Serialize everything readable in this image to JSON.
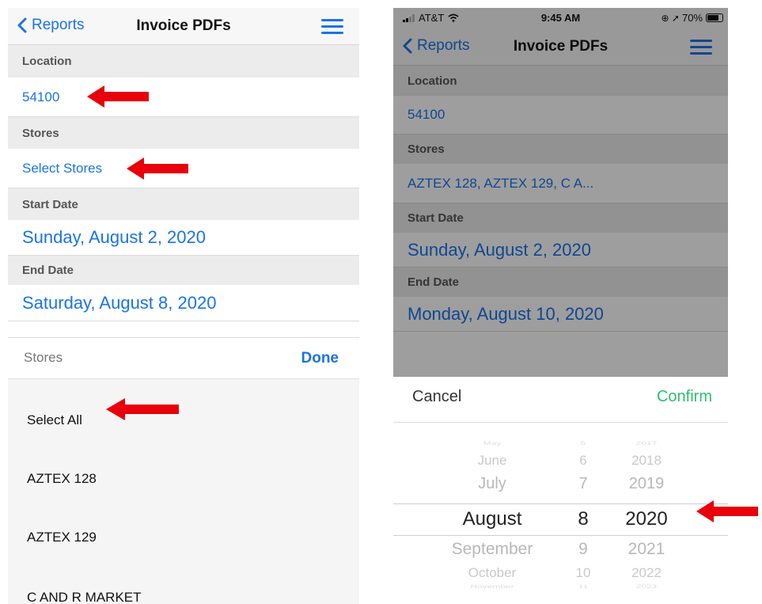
{
  "left": {
    "nav": {
      "back_label": "Reports",
      "title": "Invoice PDFs"
    },
    "location": {
      "header": "Location",
      "value": "54100"
    },
    "stores": {
      "header": "Stores",
      "value": "Select Stores"
    },
    "start_date": {
      "header": "Start Date",
      "value": "Sunday, August 2, 2020"
    },
    "end_date": {
      "header": "End Date",
      "value": "Saturday, August 8, 2020"
    },
    "sheet": {
      "label": "Stores",
      "done_label": "Done",
      "options": [
        "Select All",
        "AZTEX 128",
        "AZTEX 129",
        "C AND R MARKET"
      ]
    }
  },
  "right": {
    "status": {
      "carrier": "AT&T",
      "time": "9:45 AM",
      "battery": "70%"
    },
    "nav": {
      "back_label": "Reports",
      "title": "Invoice PDFs"
    },
    "location": {
      "header": "Location",
      "value": "54100"
    },
    "stores": {
      "header": "Stores",
      "value": "AZTEX 128, AZTEX 129, C A..."
    },
    "start_date": {
      "header": "Start Date",
      "value": "Sunday, August 2, 2020"
    },
    "end_date": {
      "header": "End Date",
      "value": "Monday, August 10, 2020"
    },
    "picker": {
      "cancel_label": "Cancel",
      "confirm_label": "Confirm",
      "months": [
        "May",
        "June",
        "July",
        "August",
        "September",
        "October",
        "November"
      ],
      "days": [
        "5",
        "6",
        "7",
        "8",
        "9",
        "10",
        "11"
      ],
      "years": [
        "2017",
        "2018",
        "2019",
        "2020",
        "2021",
        "2022",
        "2023"
      ]
    }
  },
  "colors": {
    "link_blue": "#1a73e8",
    "confirm_green": "#2ebd6f",
    "arrow_red": "#e8000b"
  }
}
